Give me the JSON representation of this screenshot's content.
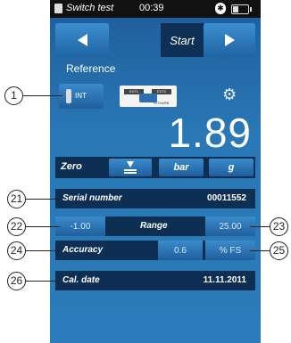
{
  "statusbar": {
    "title": "Switch test",
    "time": "00:39"
  },
  "nav": {
    "start_label": "Start"
  },
  "reference": {
    "label": "Reference",
    "int_label": "INT",
    "sensor_ext1": "EXT1",
    "sensor_ext2": "EXT2",
    "sensor_caption": "STD/ARB",
    "reading": "1.89"
  },
  "zero": {
    "label": "Zero",
    "unit_pressure": "bar",
    "unit_g": "g"
  },
  "serial": {
    "label": "Serial number",
    "value": "00011552"
  },
  "range": {
    "label": "Range",
    "min": "-1.00",
    "max": "25.00"
  },
  "accuracy": {
    "label": "Accuracy",
    "value": "0.6",
    "unit": "% FS"
  },
  "caldate": {
    "label": "Cal. date",
    "value": "11.11.2011"
  },
  "callouts": [
    "1",
    "21",
    "22",
    "23",
    "24",
    "25",
    "26"
  ],
  "colors": {
    "panel_dark": "#0d2f54",
    "button_blue": "#2b7cba"
  }
}
